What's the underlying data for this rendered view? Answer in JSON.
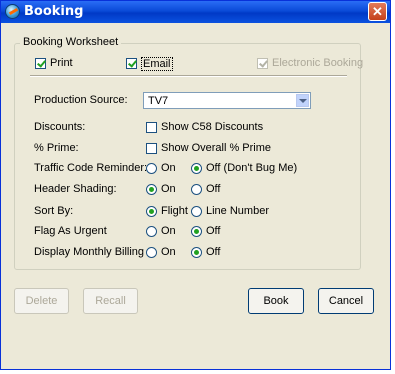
{
  "window": {
    "title": "Booking",
    "close_label": "✕"
  },
  "group": {
    "legend": "Booking Worksheet"
  },
  "top_checks": {
    "print": {
      "label": "Print",
      "checked": true
    },
    "email": {
      "label": "Email",
      "checked": true
    },
    "electronic": {
      "label": "Electronic Booking",
      "checked": true,
      "disabled": true
    }
  },
  "fields": {
    "production_source": {
      "label": "Production Source:",
      "value": "TV7"
    },
    "discounts": {
      "label": "Discounts:",
      "option": "Show C58 Discounts",
      "checked": false
    },
    "prime": {
      "label": "% Prime:",
      "option": "Show Overall % Prime",
      "checked": false
    },
    "traffic": {
      "label": "Traffic Code Reminder:",
      "opt1": "On",
      "opt2": "Off (Don't Bug Me)",
      "selected": "Off (Don't Bug Me)"
    },
    "header_shading": {
      "label": "Header Shading:",
      "opt1": "On",
      "opt2": "Off",
      "selected": "On"
    },
    "sort_by": {
      "label": "Sort By:",
      "opt1": "Flight",
      "opt2": "Line Number",
      "selected": "Flight"
    },
    "flag_urgent": {
      "label": "Flag As Urgent",
      "opt1": "On",
      "opt2": "Off",
      "selected": "Off"
    },
    "monthly_billing": {
      "label": "Display Monthly Billing",
      "opt1": "On",
      "opt2": "Off",
      "selected": "Off"
    }
  },
  "buttons": {
    "delete": "Delete",
    "recall": "Recall",
    "book": "Book",
    "cancel": "Cancel"
  }
}
